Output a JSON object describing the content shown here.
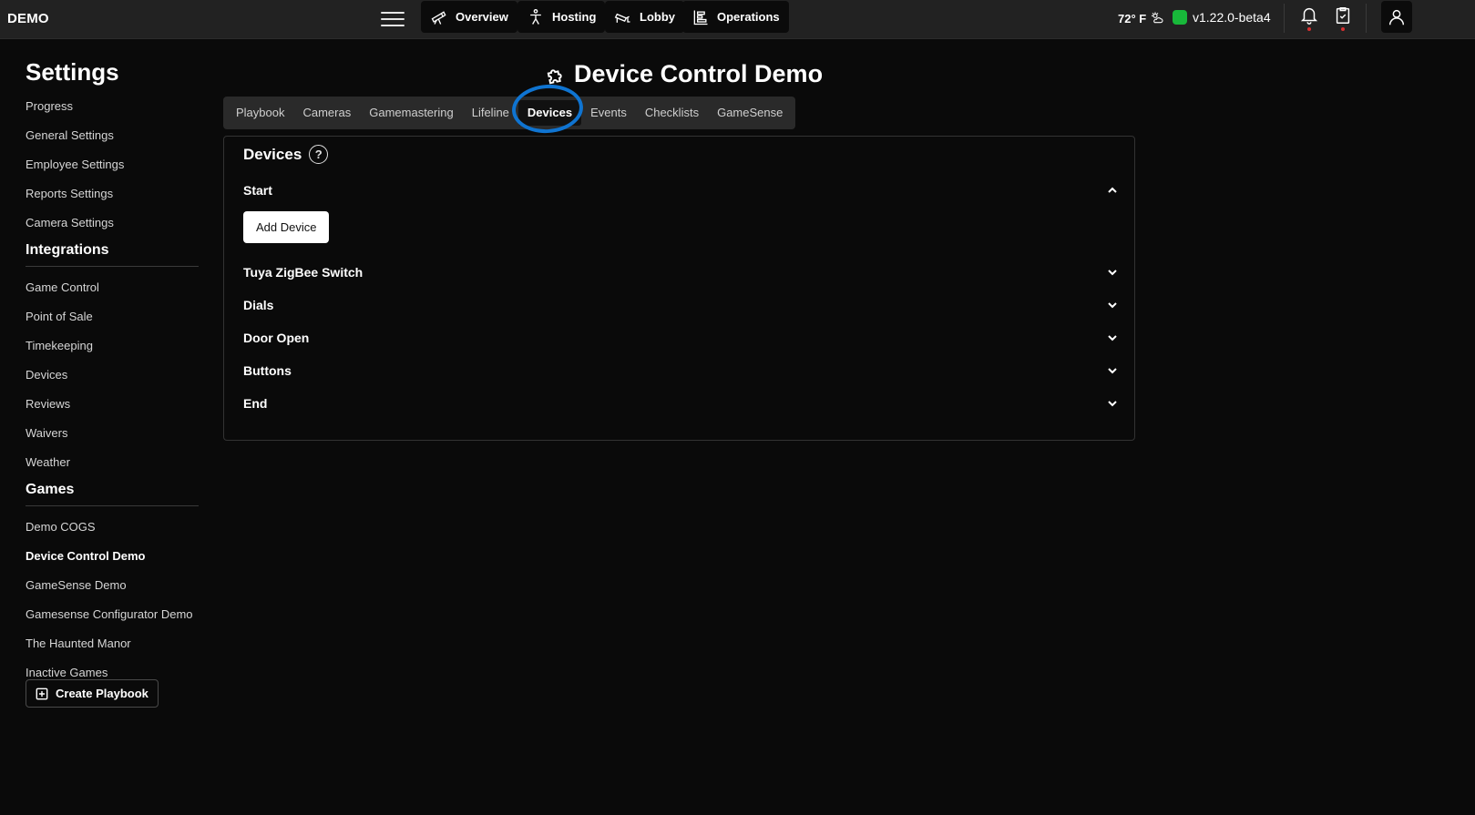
{
  "topbar": {
    "brand": "DEMO",
    "nav": [
      "Overview",
      "Hosting",
      "Lobby",
      "Operations"
    ],
    "weather": "72° F",
    "version": "v1.22.0-beta4",
    "status_color": "#18b83a"
  },
  "sidebar": {
    "title": "Settings",
    "settings_items": [
      "Progress",
      "General Settings",
      "Employee Settings",
      "Reports Settings",
      "Camera Settings"
    ],
    "integrations_title": "Integrations",
    "integrations_items": [
      "Game Control",
      "Point of Sale",
      "Timekeeping",
      "Devices",
      "Reviews",
      "Waivers",
      "Weather"
    ],
    "games_title": "Games",
    "games_items": [
      "Demo COGS",
      "Device Control Demo",
      "GameSense Demo",
      "Gamesense Configurator Demo",
      "The Haunted Manor",
      "Inactive Games"
    ],
    "create_label": "Create Playbook"
  },
  "main": {
    "title": "Device Control Demo",
    "tabs": [
      "Playbook",
      "Cameras",
      "Gamemastering",
      "Lifeline",
      "Devices",
      "Events",
      "Checklists",
      "GameSense"
    ],
    "active_tab": "Devices",
    "panel_title": "Devices",
    "help_glyph": "?",
    "sections": [
      "Start",
      "Tuya ZigBee Switch",
      "Dials",
      "Door Open",
      "Buttons",
      "End"
    ],
    "add_device_label": "Add Device"
  },
  "colors": {
    "accent_annotation": "#0f74d1",
    "alert_dot": "#d62f2f"
  }
}
